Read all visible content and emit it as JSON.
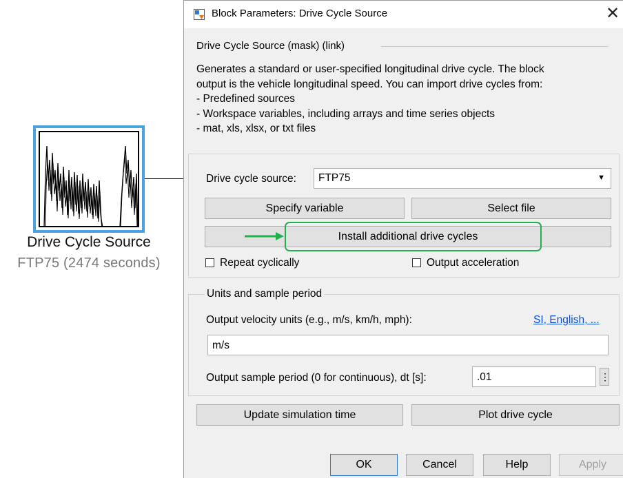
{
  "block": {
    "name": "Drive Cycle Source",
    "subtitle": "FTP75 (2474  seconds)",
    "border_color": "#4aa3df"
  },
  "dialog": {
    "title": "Block Parameters: Drive Cycle Source",
    "mask_label": "Drive Cycle Source (mask) (link)",
    "description": [
      "Generates a standard or user-specified longitudinal drive cycle. The block",
      "output is the vehicle longitudinal speed. You can import drive cycles from:",
      "- Predefined sources",
      "- Workspace variables, including arrays and time series objects",
      "- mat, xls, xlsx, or txt files"
    ],
    "drive_cycle_source": {
      "label": "Drive cycle source:",
      "value": "FTP75"
    },
    "specify_variable": "Specify variable",
    "select_file": "Select file",
    "install_additional": "Install additional drive cycles",
    "repeat_cyclically": {
      "label": "Repeat cyclically",
      "checked": false
    },
    "output_acceleration": {
      "label": "Output acceleration",
      "checked": false
    },
    "units_group": {
      "title": "Units and sample period",
      "velocity_label": "Output velocity units (e.g., m/s, km/h, mph):",
      "velocity_link": "SI, English, ...",
      "velocity_value": "m/s",
      "sample_label": "Output sample period (0 for continuous), dt [s]:",
      "sample_value": ".01"
    },
    "update_simulation_time": "Update simulation time",
    "plot_drive_cycle": "Plot drive cycle",
    "buttons": {
      "ok": "OK",
      "cancel": "Cancel",
      "help": "Help",
      "apply": "Apply"
    }
  },
  "annotation": {
    "color": "#21b14c"
  }
}
